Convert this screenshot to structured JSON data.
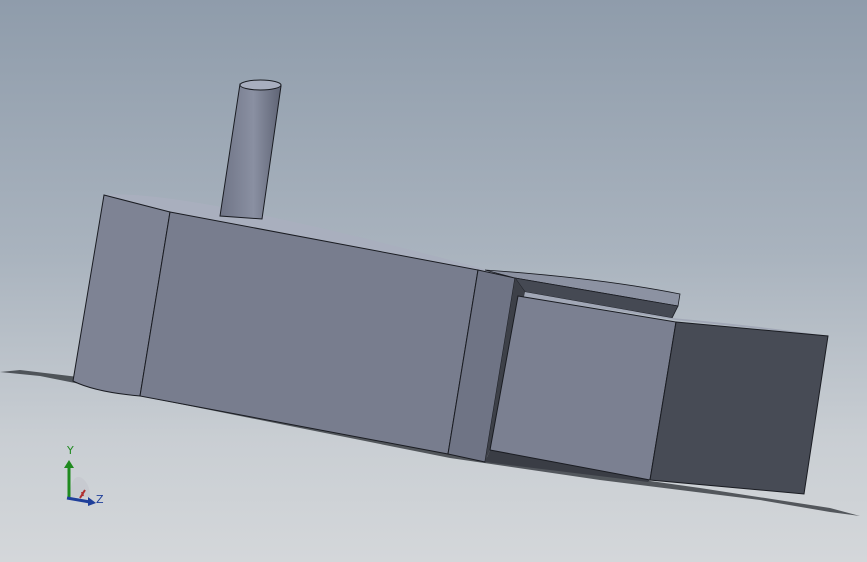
{
  "viewport": {
    "background_top": "#8f9cab",
    "background_bottom": "#d4d7da",
    "model_color": "#787d8e",
    "dark_face_color": "#474b55"
  },
  "triad": {
    "y_label": "Y",
    "z_label": "Z",
    "y_color": "#1f8a1f",
    "z_color": "#1f3f9a",
    "x_color": "#b03030"
  }
}
